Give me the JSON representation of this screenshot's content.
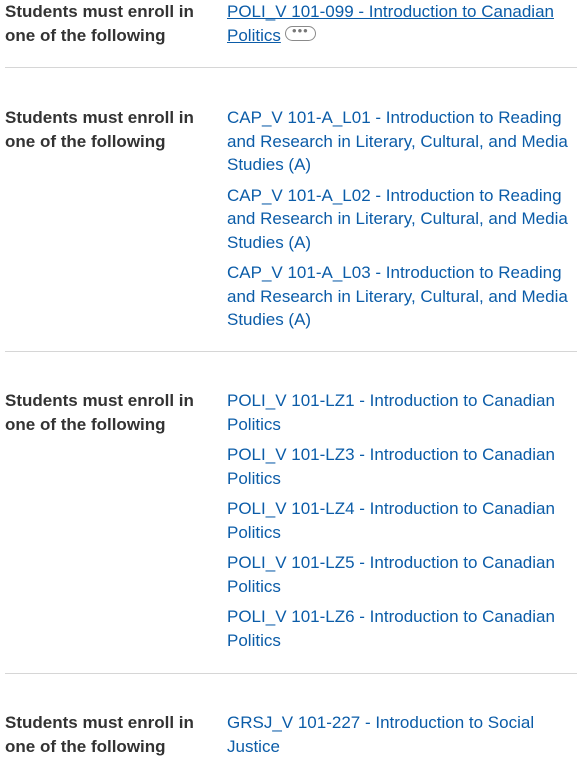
{
  "requirement_label": "Students must enroll in one of the following",
  "more_icon": "ellipsis-pill-icon",
  "groups": [
    {
      "label": "Students must enroll in one of the following",
      "courses": [
        "POLI_V 101-099 - Introduction to Canadian Politics"
      ]
    },
    {
      "label": "Students must enroll in one of the following",
      "courses": [
        "CAP_V 101-A_L01 - Introduction to Reading and Research in Literary, Cultural, and Media Studies (A)",
        "CAP_V 101-A_L02 - Introduction to Reading and Research in Literary, Cultural, and Media Studies (A)",
        "CAP_V 101-A_L03 - Introduction to Reading and Research in Literary, Cultural, and Media Studies (A)"
      ]
    },
    {
      "label": "Students must enroll in one of the following",
      "courses": [
        "POLI_V 101-LZ1 - Introduction to Canadian Politics",
        "POLI_V 101-LZ3 - Introduction to Canadian Politics",
        "POLI_V 101-LZ4 - Introduction to Canadian Politics",
        "POLI_V 101-LZ5 - Introduction to Canadian Politics",
        "POLI_V 101-LZ6 - Introduction to Canadian Politics"
      ]
    },
    {
      "label": "Students must enroll in one of the following",
      "courses": [
        "GRSJ_V 101-227 - Introduction to Social Justice"
      ]
    }
  ],
  "colors": {
    "link": "#0b5ca8",
    "label": "#333333",
    "divider": "#d6d6d6"
  }
}
